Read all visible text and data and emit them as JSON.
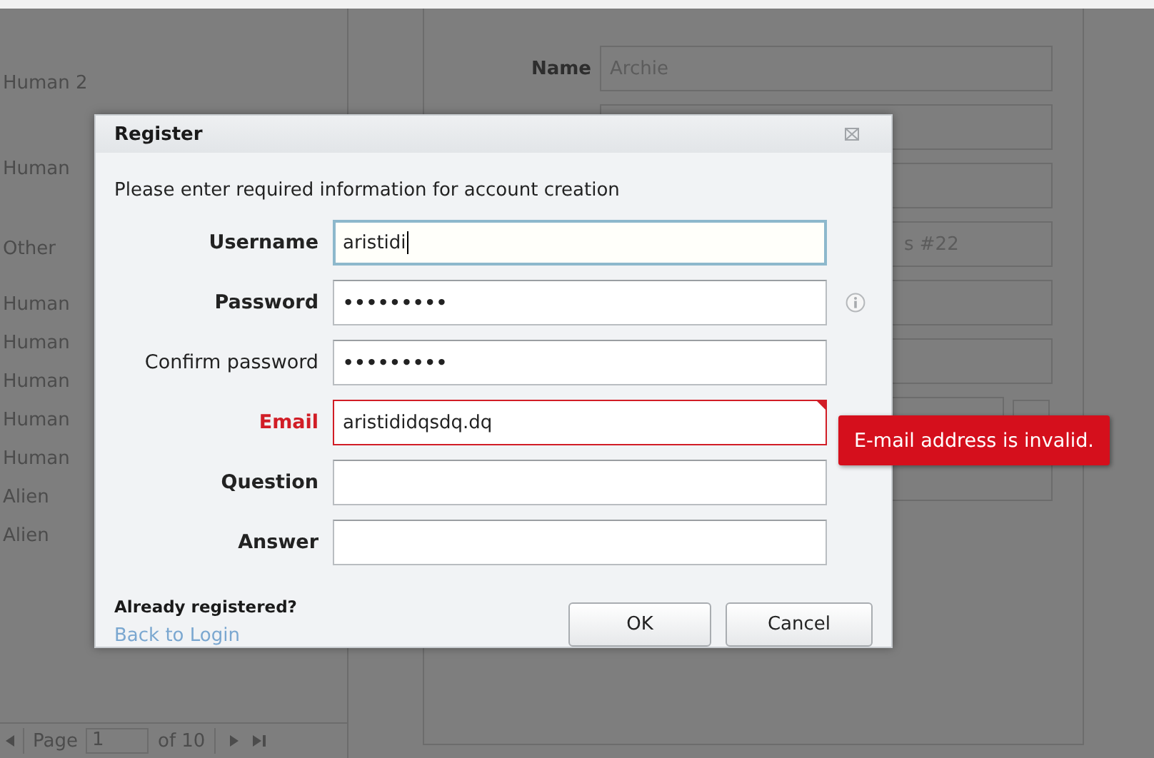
{
  "background_list": {
    "rows": [
      "Human 2",
      "Human",
      "Other",
      "Human",
      "Human",
      "Human",
      "Human",
      "Human",
      "Alien",
      "Alien"
    ]
  },
  "pager": {
    "page_label": "Page",
    "page_value": "1",
    "page_total": "of 10"
  },
  "detail": {
    "name_label": "Name",
    "name_value": "Archie",
    "field_4_text": "s #22"
  },
  "dialog": {
    "title": "Register",
    "description": "Please enter required information for account creation",
    "fields": [
      {
        "label": "Username",
        "value": "aristidi",
        "kind": "text",
        "required": true,
        "focused": true,
        "invalid": false,
        "info": false
      },
      {
        "label": "Password",
        "value": "•••••••••",
        "kind": "password",
        "required": true,
        "focused": false,
        "invalid": false,
        "info": true
      },
      {
        "label": "Confirm password",
        "value": "•••••••••",
        "kind": "password",
        "required": false,
        "focused": false,
        "invalid": false,
        "info": false
      },
      {
        "label": "Email",
        "value": "aristididqsdq.dq",
        "kind": "text",
        "required": true,
        "focused": false,
        "invalid": true,
        "info": false
      },
      {
        "label": "Question",
        "kind": "text",
        "required": true,
        "focused": false,
        "invalid": false,
        "info": false
      },
      {
        "label": "Answer",
        "kind": "text",
        "required": true,
        "focused": false,
        "invalid": false,
        "info": false
      }
    ],
    "error_tooltip": "E-mail address is invalid.",
    "footer_question": "Already registered?",
    "footer_link": "Back to Login",
    "buttons": [
      "OK",
      "Cancel"
    ]
  }
}
